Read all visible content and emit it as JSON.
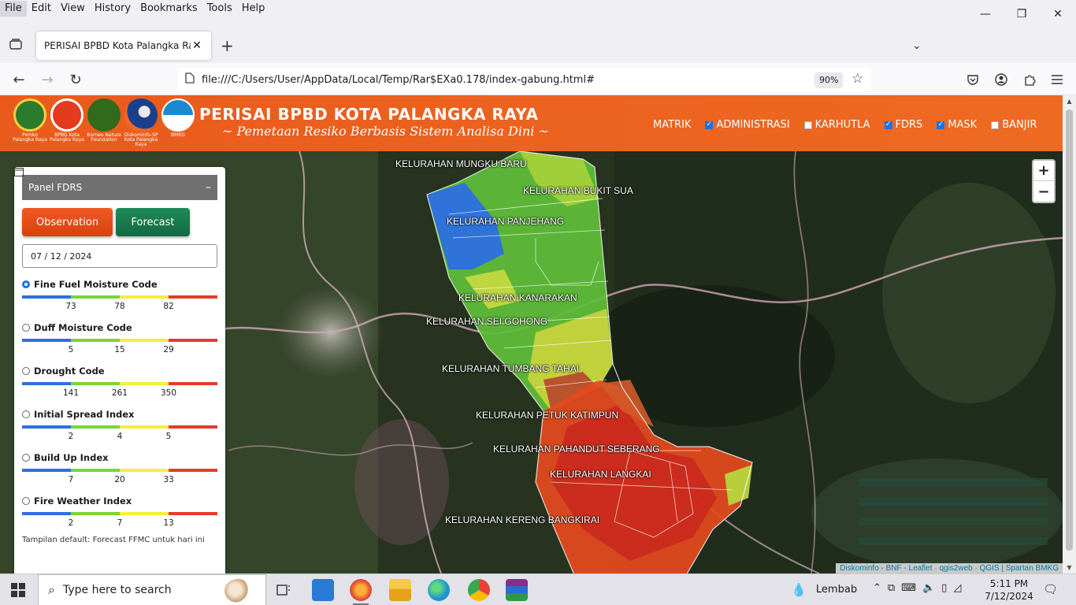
{
  "menubar": {
    "items": [
      "File",
      "Edit",
      "View",
      "History",
      "Bookmarks",
      "Tools",
      "Help"
    ]
  },
  "tab": {
    "title": "PERISAI BPBD Kota Palangka Raya",
    "close": "✕"
  },
  "toolbar": {
    "new_tab": "+",
    "overflow": "⌄",
    "back": "←",
    "forward": "→",
    "reload": "↻",
    "url": "file:///C:/Users/User/AppData/Local/Temp/Rar$EXa0.178/index-gabung.html#",
    "zoom": "90%"
  },
  "window": {
    "minimize": "—",
    "restore": "❐",
    "close": "✕"
  },
  "header": {
    "title": "PERISAI BPBD KOTA PALANGKA RAYA",
    "subtitle": "~ Pemetaan Resiko Berbasis Sistem Analisa Dini ~",
    "logos": [
      {
        "caption": "Pemko Palangka Raya",
        "color": "#2c7a2c",
        "icon": "pemko-emblem-icon"
      },
      {
        "caption": "BPBD Kota Palangka Raya",
        "color": "#e33b1e",
        "icon": "bpbd-emblem-icon"
      },
      {
        "caption": "Borneo Nature Foundation",
        "color": "#2f6b1a",
        "icon": "bnf-emblem-icon"
      },
      {
        "caption": "Diskominfo-SP Kota Palangka Raya",
        "color": "#1c3f8c",
        "icon": "diskominfo-emblem-icon"
      },
      {
        "caption": "BMKG",
        "color": "#1a8ad0",
        "icon": "bmkg-emblem-icon"
      }
    ],
    "nav": {
      "matrik": "MATRIK",
      "layers": [
        {
          "label": "ADMINISTRASI",
          "checked": true
        },
        {
          "label": "KARHUTLA",
          "checked": false
        },
        {
          "label": "FDRS",
          "checked": true
        },
        {
          "label": "MASK",
          "checked": true
        },
        {
          "label": "BANJIR",
          "checked": false
        }
      ]
    }
  },
  "panel": {
    "title": "Panel FDRS",
    "minimize": "–",
    "observation": "Observation",
    "forecast": "Forecast",
    "date": "07 / 12 / 2024",
    "scale_colors": [
      "#2d6fe0",
      "#7ad53a",
      "#f4f03a",
      "#e53b2a"
    ],
    "indices": [
      {
        "name": "Fine Fuel Moisture Code",
        "selected": true,
        "thresholds": [
          "73",
          "78",
          "82"
        ]
      },
      {
        "name": "Duff Moisture Code",
        "selected": false,
        "thresholds": [
          "5",
          "15",
          "29"
        ]
      },
      {
        "name": "Drought Code",
        "selected": false,
        "thresholds": [
          "141",
          "261",
          "350"
        ]
      },
      {
        "name": "Initial Spread Index",
        "selected": false,
        "thresholds": [
          "2",
          "4",
          "5"
        ]
      },
      {
        "name": "Build Up Index",
        "selected": false,
        "thresholds": [
          "7",
          "20",
          "33"
        ]
      },
      {
        "name": "Fire Weather Index",
        "selected": false,
        "thresholds": [
          "2",
          "7",
          "13"
        ]
      }
    ],
    "note": "Tampilan default: Forecast FFMC untuk hari ini"
  },
  "map": {
    "zoom_in": "+",
    "zoom_out": "−",
    "attribution": "Diskominfo - BNF - Leaflet · qgis2web · QGIS | Spartan BMKG",
    "kelurahan": [
      "KELURAHAN MUNGKU BARU",
      "KELURAHAN BUKIT SUA",
      "KELURAHAN PANJEHANG",
      "KELURAHAN KANARAKAN",
      "KELURAHAN SEI GOHONG",
      "KELURAHAN TUMBANG TAHAI",
      "KELURAHAN PETUK KATIMPUN",
      "KELURAHAN PAHANDUT SEBERANG",
      "KELURAHAN LANGKAI",
      "KELURAHAN KERENG BANGKIRAI"
    ]
  },
  "taskbar": {
    "search_placeholder": "Type here to search",
    "weather": "Lembab",
    "time": "5:11 PM",
    "date": "7/12/2024"
  }
}
